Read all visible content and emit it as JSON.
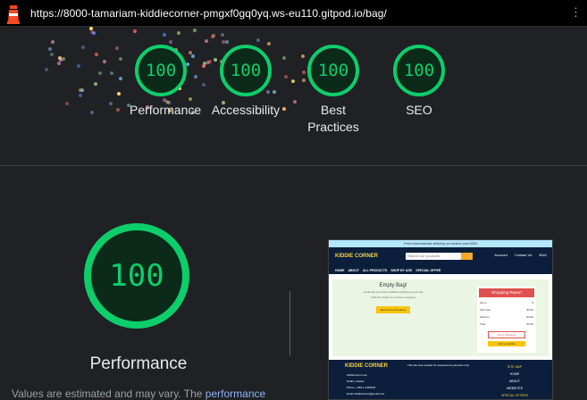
{
  "browser": {
    "url": "https://8000-tamariam-kiddiecorner-pmgxf0gq0yq.ws-eu110.gitpod.io/bag/"
  },
  "summary": {
    "gauges": [
      {
        "score": "100",
        "label": "Performance"
      },
      {
        "score": "100",
        "label": "Accessibility"
      },
      {
        "score": "100",
        "label": "Best Practices"
      },
      {
        "score": "100",
        "label": "SEO"
      }
    ]
  },
  "performance": {
    "score": "100",
    "title": "Performance",
    "note_prefix": "Values are estimated and may vary. The",
    "note_link": "performance"
  },
  "screenshot": {
    "banner": "Free international delivery on orders over £50!",
    "logo": "KIDDIE CORNER",
    "search_placeholder": "Search our products",
    "header_icons": [
      "Account",
      "Contact Us",
      "BAG"
    ],
    "nav": [
      "HOME",
      "ABOUT",
      "ALL PRODUCTS",
      "SHOP BY AGE",
      "SPECIAL OFFER"
    ],
    "empty_title": "Empty Bag!",
    "empty_sub1": "Looks like you haven't added anything to your bag",
    "empty_sub2": "Click the button to continue shopping",
    "continue_btn": "Back Home Products",
    "report_title": "Shopping Report",
    "report_rows": [
      {
        "k": "Items",
        "v": "0"
      },
      {
        "k": "Sub total",
        "v": "€0.00"
      },
      {
        "k": "Delivery",
        "v": "€0.00"
      },
      {
        "k": "Total",
        "v": "€0.00"
      }
    ],
    "report_btn1": "Go to Checkout",
    "report_btn2": "Add to wishlist",
    "footer_logo": "KIDDIE CORNER",
    "footer_mid": "This site was created for assessment purposes only",
    "footer_site_map": [
      "SITE MAP",
      "HOME",
      "ABOUT",
      "WEBSITES",
      "SPECIAL OFFERS"
    ],
    "footer_contact": [
      "Kiddiecorner.com",
      "Dublin, Ireland",
      "Phone: +353 1 2345678",
      "Email: kiddiecorner@gmail.com"
    ]
  },
  "colors": {
    "pass_green": "#0cce6b",
    "background": "#202124",
    "link_blue": "#8ab4f8"
  }
}
